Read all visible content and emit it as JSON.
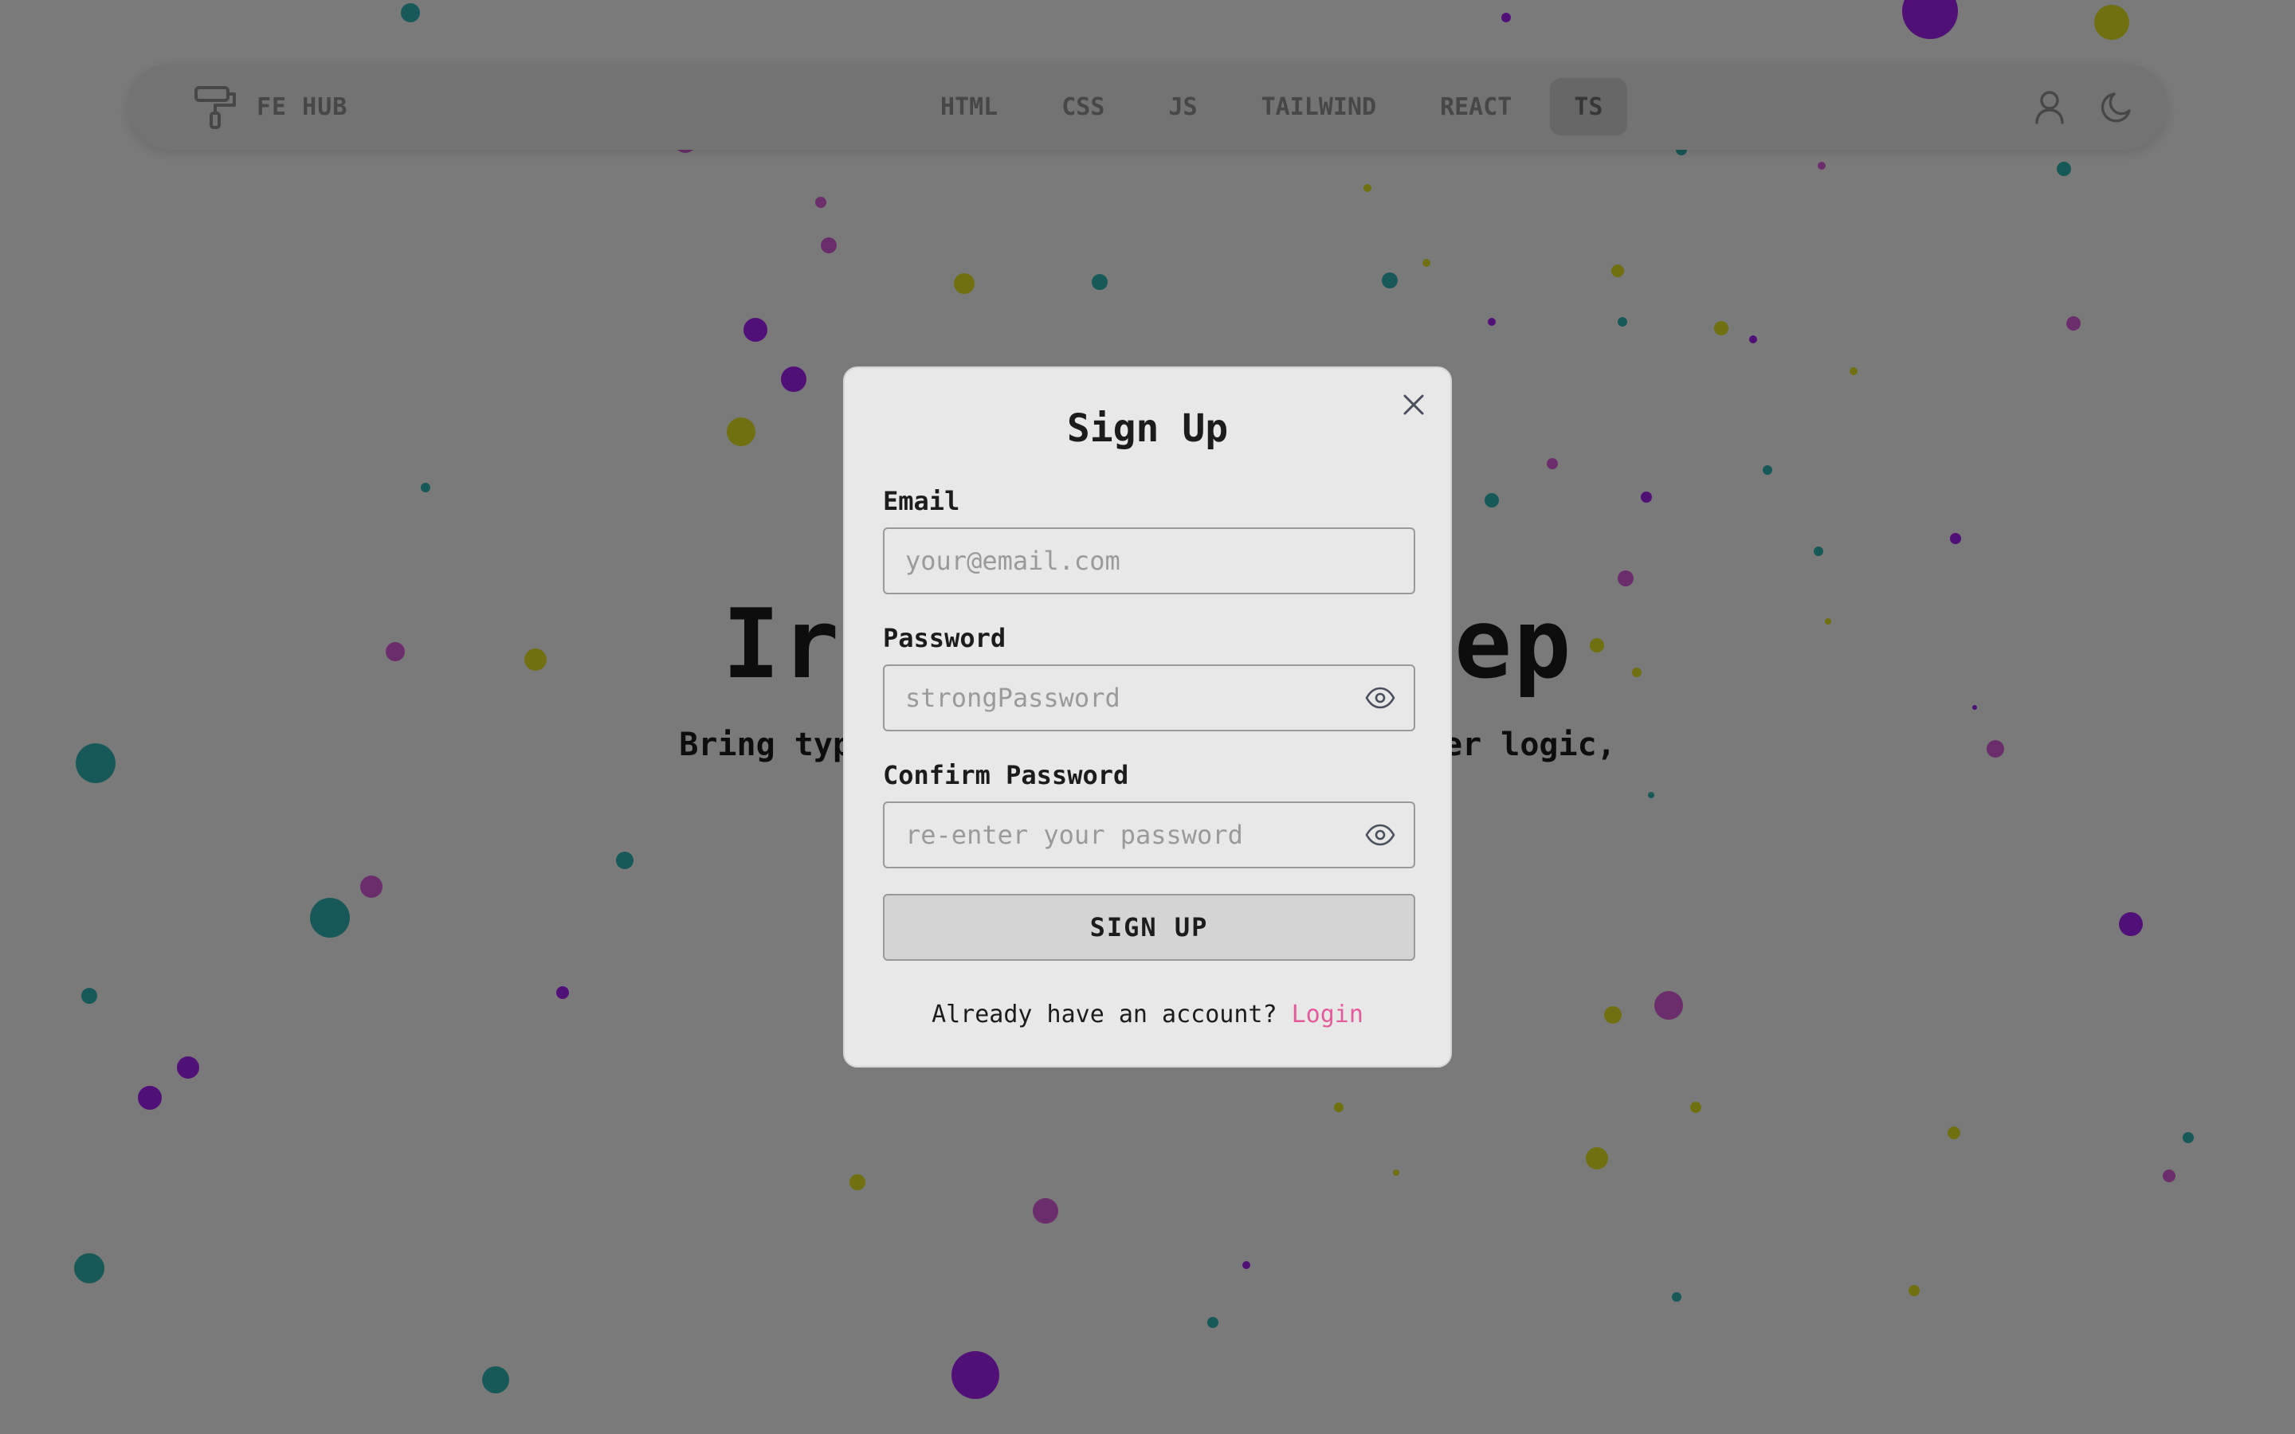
{
  "colors": {
    "page_background": "#f5f5f5",
    "overlay": "rgba(0,0,0,0.5)",
    "modal_background": "#e8e8e8",
    "link_pink": "#e25b9a",
    "confetti_cyan": "#2fb3b3",
    "confetti_purple": "#a020f0",
    "confetti_magenta": "#d75ad7",
    "confetti_yellow": "#e0e020"
  },
  "navbar": {
    "brand_icon": "paint-roller-icon",
    "brand_name": "FE HUB",
    "links": [
      {
        "label": "HTML",
        "active": false
      },
      {
        "label": "CSS",
        "active": false
      },
      {
        "label": "JS",
        "active": false
      },
      {
        "label": "TAILWIND",
        "active": false
      },
      {
        "label": "REACT",
        "active": false
      },
      {
        "label": "TS",
        "active": true
      }
    ],
    "user_icon": "user-icon",
    "theme_icon": "moon-icon"
  },
  "hero": {
    "title_visible_left": "Ir",
    "title_visible_right": "ep",
    "subtitle_visible_left": "Bring typ",
    "subtitle_visible_right": "er logic,"
  },
  "modal": {
    "title": "Sign Up",
    "close_icon": "close-icon",
    "email": {
      "label": "Email",
      "placeholder": "your@email.com",
      "value": ""
    },
    "password": {
      "label": "Password",
      "placeholder": "strongPassword",
      "value": "",
      "toggle_icon": "eye-icon"
    },
    "confirm": {
      "label": "Confirm Password",
      "placeholder": "re-enter your password",
      "value": "",
      "toggle_icon": "eye-icon"
    },
    "submit_label": "SIGN UP",
    "footer_text": "Already have an account? ",
    "login_label": "Login"
  }
}
